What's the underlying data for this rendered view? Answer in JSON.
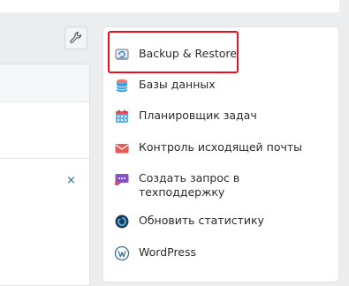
{
  "toolbar": {
    "tools_icon": "wrench-icon"
  },
  "left_panel": {
    "close_symbol": "×"
  },
  "menu": {
    "items": [
      {
        "label": "Backup & Restore",
        "icon": "backup-restore-icon"
      },
      {
        "label": "Базы данных",
        "icon": "database-icon"
      },
      {
        "label": "Планировщик задач",
        "icon": "calendar-icon"
      },
      {
        "label": "Контроль исходящей почты",
        "icon": "mail-icon"
      },
      {
        "label": "Создать запрос в техподдержку",
        "icon": "support-chat-icon"
      },
      {
        "label": "Обновить статистику",
        "icon": "refresh-stats-icon"
      },
      {
        "label": "WordPress",
        "icon": "wordpress-icon"
      }
    ]
  },
  "colors": {
    "highlight": "#e8101a",
    "link": "#1a73b5"
  }
}
